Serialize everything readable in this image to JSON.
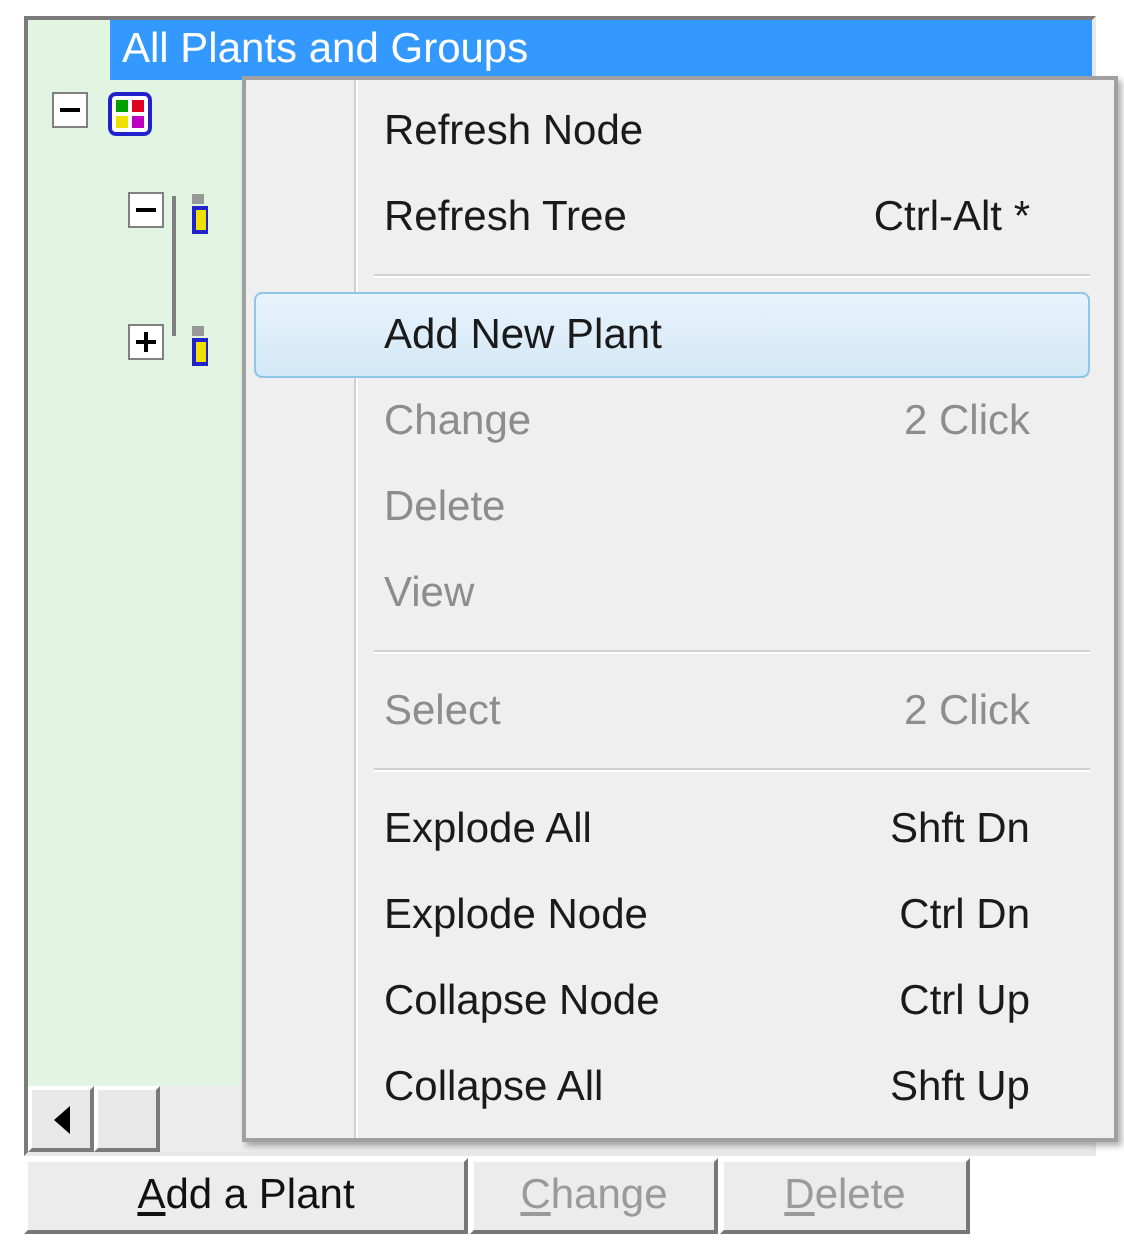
{
  "tree": {
    "root_label": "All Plants and Groups",
    "root_selected": true,
    "nodes": [
      {
        "expanded": true,
        "children": [
          {
            "expanded": true
          },
          {
            "expanded": false
          }
        ]
      }
    ]
  },
  "context_menu": {
    "items": [
      {
        "kind": "item",
        "label": "Refresh Node",
        "disabled": false,
        "selected": false
      },
      {
        "kind": "item",
        "label": "Refresh Tree",
        "shortcut": "Ctrl-Alt *",
        "disabled": false,
        "selected": false
      },
      {
        "kind": "separator"
      },
      {
        "kind": "item",
        "label": "Add New Plant",
        "disabled": false,
        "selected": true
      },
      {
        "kind": "item",
        "label": "Change",
        "shortcut": "2 Click",
        "disabled": true,
        "selected": false
      },
      {
        "kind": "item",
        "label": "Delete",
        "disabled": true,
        "selected": false
      },
      {
        "kind": "item",
        "label": "View",
        "disabled": true,
        "selected": false
      },
      {
        "kind": "separator"
      },
      {
        "kind": "item",
        "label": "Select",
        "shortcut": "2 Click",
        "disabled": true,
        "selected": false
      },
      {
        "kind": "separator"
      },
      {
        "kind": "item",
        "label": "Explode All",
        "shortcut": "Shft Dn",
        "disabled": false,
        "selected": false
      },
      {
        "kind": "item",
        "label": "Explode Node",
        "shortcut": "Ctrl Dn",
        "disabled": false,
        "selected": false
      },
      {
        "kind": "item",
        "label": "Collapse Node",
        "shortcut": "Ctrl Up",
        "disabled": false,
        "selected": false
      },
      {
        "kind": "item",
        "label": "Collapse All",
        "shortcut": "Shft Up",
        "disabled": false,
        "selected": false
      }
    ]
  },
  "buttons": [
    {
      "label": "Add a Plant",
      "disabled": false
    },
    {
      "label": "Change",
      "disabled": true
    },
    {
      "label": "Delete",
      "disabled": true
    }
  ]
}
